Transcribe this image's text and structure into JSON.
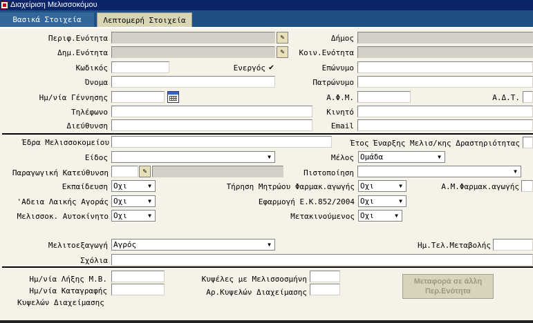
{
  "window": {
    "title": "Διαχείριση Μελισσοκόμου"
  },
  "tabs": [
    {
      "label": "Βασικά Στοιχεία"
    },
    {
      "label": "Λεπτομερή Στοιχεία"
    }
  ],
  "form": {
    "perif_enotita": {
      "label": "Περιφ.Ενότητα",
      "value": ""
    },
    "dimos": {
      "label": "Δήμος",
      "value": ""
    },
    "dim_enotita": {
      "label": "Δημ.Ενότητα",
      "value": ""
    },
    "koin_enotita": {
      "label": "Κοιν.Ενότητα",
      "value": ""
    },
    "kodikos": {
      "label": "Κωδικός",
      "value": ""
    },
    "energos": {
      "label": "Ενεργός",
      "checked": true,
      "mark": "✔"
    },
    "eponymo": {
      "label": "Επώνυμο",
      "value": ""
    },
    "onoma": {
      "label": "Όνομα",
      "value": ""
    },
    "patronymo": {
      "label": "Πατρώνυμο",
      "value": ""
    },
    "hm_gennisis": {
      "label": "Ημ/νία Γέννησης",
      "value": ""
    },
    "afm": {
      "label": "Α.Φ.Μ.",
      "value": ""
    },
    "adt": {
      "label": "Α.Δ.Τ.",
      "value": ""
    },
    "tilefono": {
      "label": "Τηλέφωνο",
      "value": ""
    },
    "kinito": {
      "label": "Κινητό",
      "value": ""
    },
    "dieythynsi": {
      "label": "Διεύθυνση",
      "value": ""
    },
    "email": {
      "label": "Email",
      "value": ""
    },
    "edra": {
      "label": "Έδρα Μελισσοκομείου",
      "value": ""
    },
    "etos_enarxis": {
      "label": "Έτος Έναρξης Μελισ/κης Δραστηριότητας",
      "value": ""
    },
    "eidos": {
      "label": "Είδος",
      "value": ""
    },
    "melos": {
      "label": "Μέλος",
      "value": "Ομάδα"
    },
    "paragogiki": {
      "label": "Παραγωγική Κατεύθυνση",
      "value": ""
    },
    "pistopoiisi": {
      "label": "Πιστοποίηση",
      "value": ""
    },
    "ekpaidefsi": {
      "label": "Εκπαίδευση",
      "value": "Οχι"
    },
    "tirisi": {
      "label": "Τήρηση Μητρώου Φαρμακ.αγωγής",
      "value": "Οχι"
    },
    "am_farmak": {
      "label": "Α.Μ.Φαρμακ.αγωγής",
      "value": ""
    },
    "adeia": {
      "label": "'Αδεια Λαικής Αγοράς",
      "value": "Οχι"
    },
    "efarmogi": {
      "label": "Εφαρμογή Ε.Κ.852/2004",
      "value": "Οχι"
    },
    "autokinito": {
      "label": "Μελισσοκ. Αυτοκίνητο",
      "value": "Οχι"
    },
    "metakinoumenos": {
      "label": "Μετακινούμενος",
      "value": "Οχι"
    },
    "melitoexagogi": {
      "label": "Μελιτοεξαγωγή",
      "value": "Αγρός"
    },
    "hm_tel_metavolis": {
      "label": "Ημ.Τελ.Μεταβολής",
      "value": ""
    },
    "sxolia": {
      "label": "Σχόλια",
      "value": ""
    },
    "hm_lixis": {
      "label": "Ημ/νία Λήξης Μ.Β.",
      "value": ""
    },
    "kypseles_melissosmini": {
      "label": "Κυψέλες με Μελισσοσμήνη",
      "value": ""
    },
    "hm_katagrafis": {
      "label": "Ημ/νία Καταγραφής",
      "value": ""
    },
    "kypselon_diax_label": {
      "label": "Κυψελών Διαχείμασης"
    },
    "ar_kypselon": {
      "label": "Αρ.Κυψελών Διαχείμασης",
      "value": ""
    }
  },
  "buttons": {
    "metafora": "Μεταφορά σε άλλη Περ.Ενότητα"
  },
  "icons": {
    "lov": "edit-list-icon",
    "calendar": "calendar-icon",
    "dropdown": "dropdown-arrow-icon",
    "app": "app-icon"
  },
  "colors": {
    "titlebar": "#0a246a",
    "tab_active": "#336699",
    "tabstrip": "#1f4f84",
    "readonly": "#d4d0c8",
    "background": "#f5f2e8"
  }
}
